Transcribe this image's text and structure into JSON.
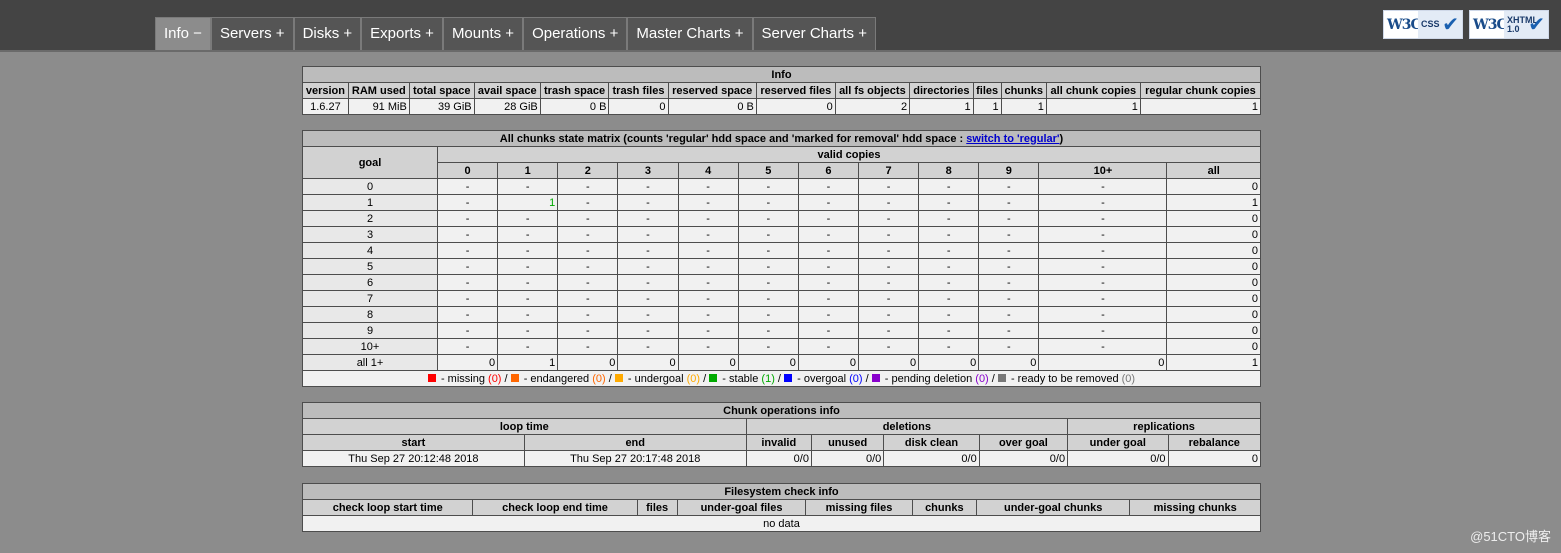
{
  "tabs": [
    {
      "label": "Info −",
      "active": true
    },
    {
      "label": "Servers +"
    },
    {
      "label": "Disks +"
    },
    {
      "label": "Exports +"
    },
    {
      "label": "Mounts +"
    },
    {
      "label": "Operations +"
    },
    {
      "label": "Master Charts +"
    },
    {
      "label": "Server Charts +"
    }
  ],
  "badges": {
    "css": {
      "w3": "W3C",
      "text": "CSS"
    },
    "xhtml": {
      "w3": "W3C",
      "text": "XHTML 1.0"
    }
  },
  "info": {
    "title": "Info",
    "headers": [
      "version",
      "RAM used",
      "total space",
      "avail space",
      "trash space",
      "trash files",
      "reserved space",
      "reserved files",
      "all fs objects",
      "directories",
      "files",
      "chunks",
      "all chunk copies",
      "regular chunk copies"
    ],
    "values": [
      "1.6.27",
      "91 MiB",
      "39 GiB",
      "28 GiB",
      "0 B",
      "0",
      "0 B",
      "0",
      "2",
      "1",
      "1",
      "1",
      "1",
      "1"
    ]
  },
  "matrix": {
    "title_prefix": "All chunks state matrix (counts 'regular' hdd space and 'marked for removal' hdd space : ",
    "switch_link": "switch to 'regular'",
    "title_suffix": ")",
    "goal_header": "goal",
    "valid_header": "valid copies",
    "columns": [
      "0",
      "1",
      "2",
      "3",
      "4",
      "5",
      "6",
      "7",
      "8",
      "9",
      "10+",
      "all"
    ],
    "rows": [
      {
        "goal": "0",
        "cells": [
          "-",
          "-",
          "-",
          "-",
          "-",
          "-",
          "-",
          "-",
          "-",
          "-",
          "-",
          "0"
        ]
      },
      {
        "goal": "1",
        "cells": [
          "-",
          "1",
          "-",
          "-",
          "-",
          "-",
          "-",
          "-",
          "-",
          "-",
          "-",
          "1"
        ]
      },
      {
        "goal": "2",
        "cells": [
          "-",
          "-",
          "-",
          "-",
          "-",
          "-",
          "-",
          "-",
          "-",
          "-",
          "-",
          "0"
        ]
      },
      {
        "goal": "3",
        "cells": [
          "-",
          "-",
          "-",
          "-",
          "-",
          "-",
          "-",
          "-",
          "-",
          "-",
          "-",
          "0"
        ]
      },
      {
        "goal": "4",
        "cells": [
          "-",
          "-",
          "-",
          "-",
          "-",
          "-",
          "-",
          "-",
          "-",
          "-",
          "-",
          "0"
        ]
      },
      {
        "goal": "5",
        "cells": [
          "-",
          "-",
          "-",
          "-",
          "-",
          "-",
          "-",
          "-",
          "-",
          "-",
          "-",
          "0"
        ]
      },
      {
        "goal": "6",
        "cells": [
          "-",
          "-",
          "-",
          "-",
          "-",
          "-",
          "-",
          "-",
          "-",
          "-",
          "-",
          "0"
        ]
      },
      {
        "goal": "7",
        "cells": [
          "-",
          "-",
          "-",
          "-",
          "-",
          "-",
          "-",
          "-",
          "-",
          "-",
          "-",
          "0"
        ]
      },
      {
        "goal": "8",
        "cells": [
          "-",
          "-",
          "-",
          "-",
          "-",
          "-",
          "-",
          "-",
          "-",
          "-",
          "-",
          "0"
        ]
      },
      {
        "goal": "9",
        "cells": [
          "-",
          "-",
          "-",
          "-",
          "-",
          "-",
          "-",
          "-",
          "-",
          "-",
          "-",
          "0"
        ]
      },
      {
        "goal": "10+",
        "cells": [
          "-",
          "-",
          "-",
          "-",
          "-",
          "-",
          "-",
          "-",
          "-",
          "-",
          "-",
          "0"
        ]
      }
    ],
    "total_row": {
      "goal": "all 1+",
      "cells": [
        "0",
        "1",
        "0",
        "0",
        "0",
        "0",
        "0",
        "0",
        "0",
        "0",
        "0",
        "1"
      ]
    },
    "legend": [
      {
        "color": "#ff0000",
        "label": " - missing ",
        "count": "(0)",
        "count_color": "#ff0000"
      },
      {
        "color": "#ff6600",
        "label": " - endangered ",
        "count": "(0)",
        "count_color": "#ff6600"
      },
      {
        "color": "#ffaa00",
        "label": " - undergoal ",
        "count": "(0)",
        "count_color": "#ffaa00"
      },
      {
        "color": "#00aa00",
        "label": " - stable ",
        "count": "(1)",
        "count_color": "#00aa00"
      },
      {
        "color": "#0000ff",
        "label": " - overgoal ",
        "count": "(0)",
        "count_color": "#0000ff"
      },
      {
        "color": "#8800cc",
        "label": " - pending deletion ",
        "count": "(0)",
        "count_color": "#8800cc"
      },
      {
        "color": "#777777",
        "label": " - ready to be removed ",
        "count": "(0)",
        "count_color": "#777777"
      }
    ]
  },
  "chunkops": {
    "title": "Chunk operations info",
    "loop_time": "loop time",
    "deletions": "deletions",
    "replications": "replications",
    "headers": [
      "start",
      "end",
      "invalid",
      "unused",
      "disk clean",
      "over goal",
      "under goal",
      "rebalance"
    ],
    "values": [
      "Thu Sep 27 20:12:48 2018",
      "Thu Sep 27 20:17:48 2018",
      "0/0",
      "0/0",
      "0/0",
      "0/0",
      "0/0",
      "0"
    ]
  },
  "fscheck": {
    "title": "Filesystem check info",
    "headers": [
      "check loop start time",
      "check loop end time",
      "files",
      "under-goal files",
      "missing files",
      "chunks",
      "under-goal chunks",
      "missing chunks"
    ],
    "nodata": "no data"
  },
  "watermark": "@51CTO博客"
}
